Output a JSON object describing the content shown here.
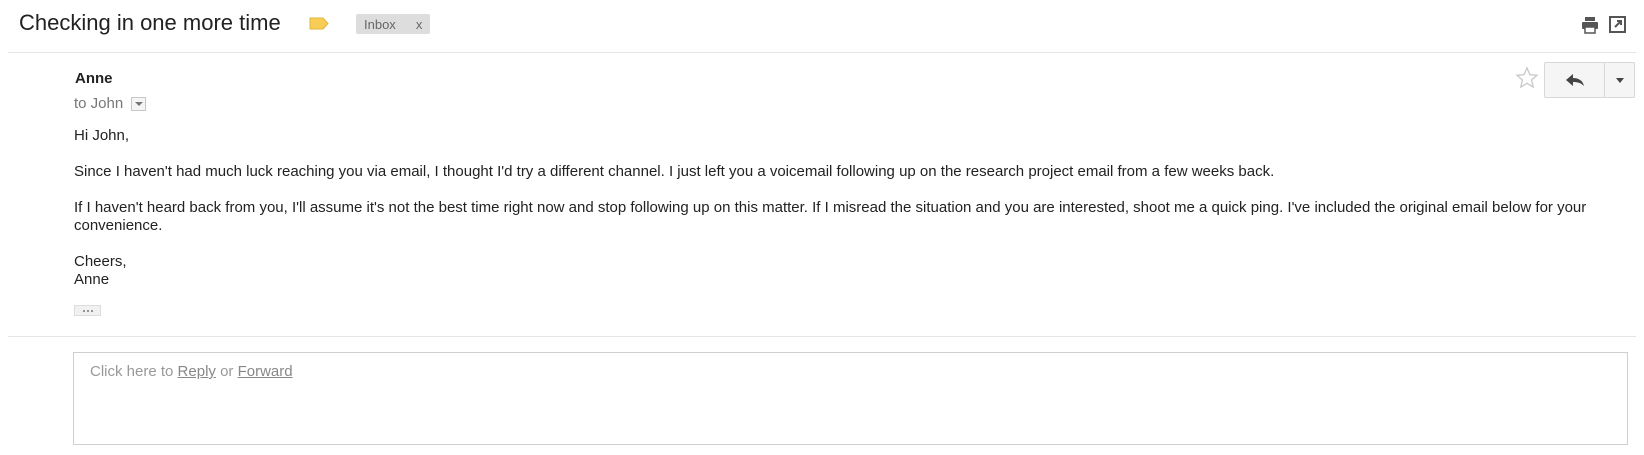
{
  "thread": {
    "subject": "Checking in one more time",
    "label": "Inbox",
    "label_remove": "x"
  },
  "message": {
    "sender": "Anne",
    "to_line": "to John",
    "greeting": "Hi John,",
    "paragraph1": "Since I haven't had much luck reaching you via email, I thought I'd try a different channel. I just left you a voicemail following up on the research project email from a few weeks back.",
    "paragraph2": "If I haven't heard back from you, I'll assume it's not the best time right now and stop following up on this matter. If I misread the situation and you are interested, shoot me a quick ping. I've included the original email below for your convenience.",
    "closing": "Cheers,",
    "signature": "Anne"
  },
  "reply_box": {
    "prefix": "Click here to ",
    "reply_link": "Reply",
    "or_text": " or ",
    "forward_link": "Forward"
  },
  "icons": {
    "label_tag": "label-tag-icon",
    "print": "print-icon",
    "new_window": "new-window-icon",
    "star": "star-icon",
    "reply": "reply-arrow-icon",
    "more": "chevron-down-icon"
  },
  "colors": {
    "label_tag": "#f7cd56",
    "chip_bg": "#dddddd"
  }
}
